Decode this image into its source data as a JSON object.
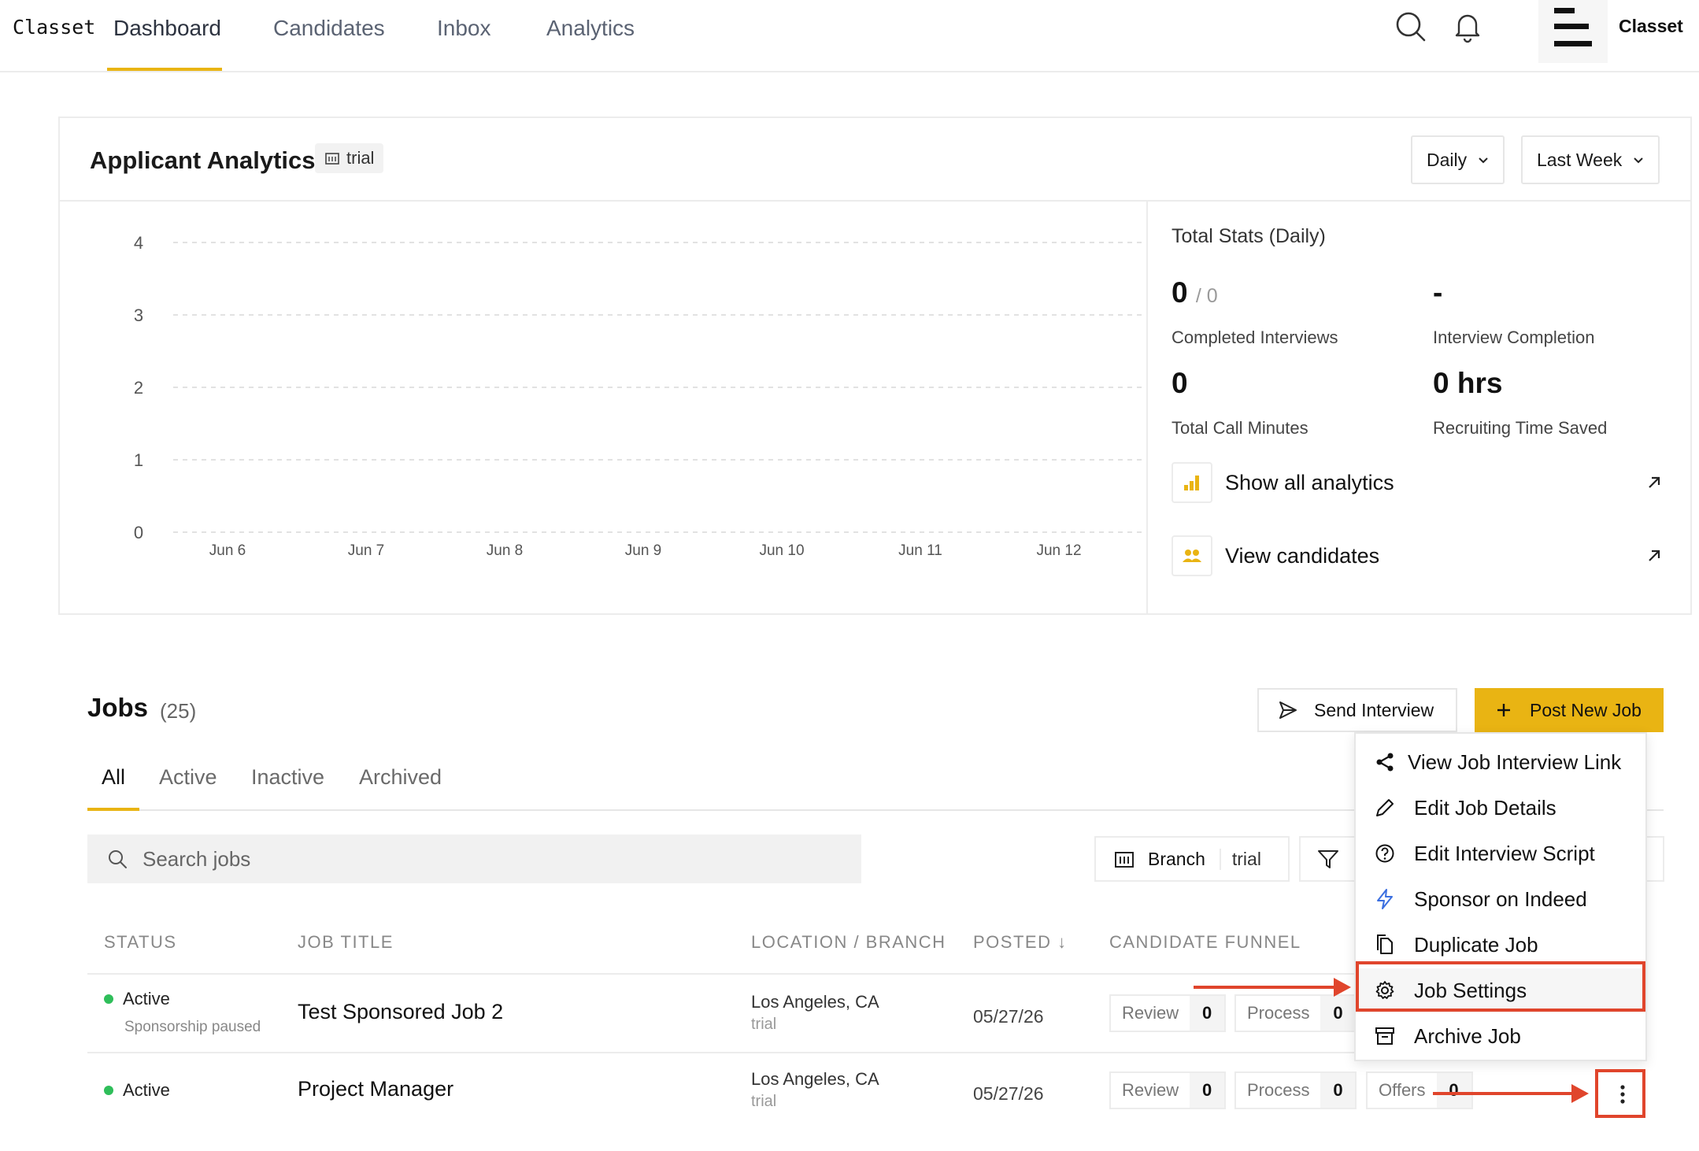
{
  "nav": {
    "logo": "Classet",
    "tabs": [
      {
        "label": "Dashboard",
        "active": true
      },
      {
        "label": "Candidates"
      },
      {
        "label": "Inbox"
      },
      {
        "label": "Analytics"
      }
    ],
    "user_name": "Classet",
    "accent_color": "#e9b413"
  },
  "analytics": {
    "title": "Applicant Analytics",
    "branch_badge": "trial",
    "interval": "Daily",
    "range": "Last Week",
    "stats_title": "Total Stats (Daily)",
    "stats": [
      {
        "value": "0",
        "sub": "/ 0",
        "label": "Completed Interviews"
      },
      {
        "value": "-",
        "sub": "",
        "label": "Interview Completion"
      },
      {
        "value": "0",
        "sub": "",
        "label": "Total Call Minutes"
      },
      {
        "value": "0 hrs",
        "sub": "",
        "label": "Recruiting Time Saved"
      }
    ],
    "links": [
      {
        "label": "Show all analytics",
        "icon": "bar-chart-icon"
      },
      {
        "label": "View candidates",
        "icon": "users-icon"
      }
    ]
  },
  "chart_data": {
    "type": "line",
    "categories": [
      "Jun 6",
      "Jun 7",
      "Jun 8",
      "Jun 9",
      "Jun 10",
      "Jun 11",
      "Jun 12"
    ],
    "series": [
      {
        "values": [
          0,
          0,
          0,
          0,
          0,
          0,
          0
        ]
      }
    ],
    "y_ticks": [
      "0",
      "1",
      "2",
      "3",
      "4"
    ],
    "ylim": [
      0,
      4
    ],
    "grid": true,
    "title": "",
    "xlabel": "",
    "ylabel": ""
  },
  "jobs": {
    "title": "Jobs",
    "count": "(25)",
    "send_interview_label": "Send Interview",
    "post_job_label": "Post New Job",
    "tabs": [
      {
        "label": "All",
        "active": true
      },
      {
        "label": "Active"
      },
      {
        "label": "Inactive"
      },
      {
        "label": "Archived"
      }
    ],
    "search_placeholder": "Search jobs",
    "branch_filter": {
      "label": "Branch",
      "value": "trial"
    },
    "columns": [
      "STATUS",
      "JOB TITLE",
      "LOCATION / BRANCH",
      "POSTED ↓",
      "CANDIDATE FUNNEL"
    ],
    "rows": [
      {
        "status": "Active",
        "status_sub": "Sponsorship paused",
        "title": "Test Sponsored Job 2",
        "location": "Los Angeles, CA",
        "branch": "trial",
        "posted": "05/27/26",
        "funnel": [
          {
            "label": "Review",
            "count": "0"
          },
          {
            "label": "Process",
            "count": "0"
          }
        ]
      },
      {
        "status": "Active",
        "status_sub": "",
        "title": "Project Manager",
        "location": "Los Angeles, CA",
        "branch": "trial",
        "posted": "05/27/26",
        "funnel": [
          {
            "label": "Review",
            "count": "0"
          },
          {
            "label": "Process",
            "count": "0"
          },
          {
            "label": "Offers",
            "count": "0"
          }
        ]
      }
    ]
  },
  "menu": {
    "items": [
      {
        "label": "View Job Interview Link",
        "icon": "share-icon"
      },
      {
        "label": "Edit Job Details",
        "icon": "pencil-icon"
      },
      {
        "label": "Edit Interview Script",
        "icon": "question-circle-icon"
      },
      {
        "label": "Sponsor on Indeed",
        "icon": "lightning-icon"
      },
      {
        "label": "Duplicate Job",
        "icon": "copy-icon"
      },
      {
        "label": "Job Settings",
        "icon": "gear-icon",
        "highlighted": true
      },
      {
        "label": "Archive Job",
        "icon": "archive-icon"
      }
    ]
  },
  "annotation_color": "#e0452c"
}
